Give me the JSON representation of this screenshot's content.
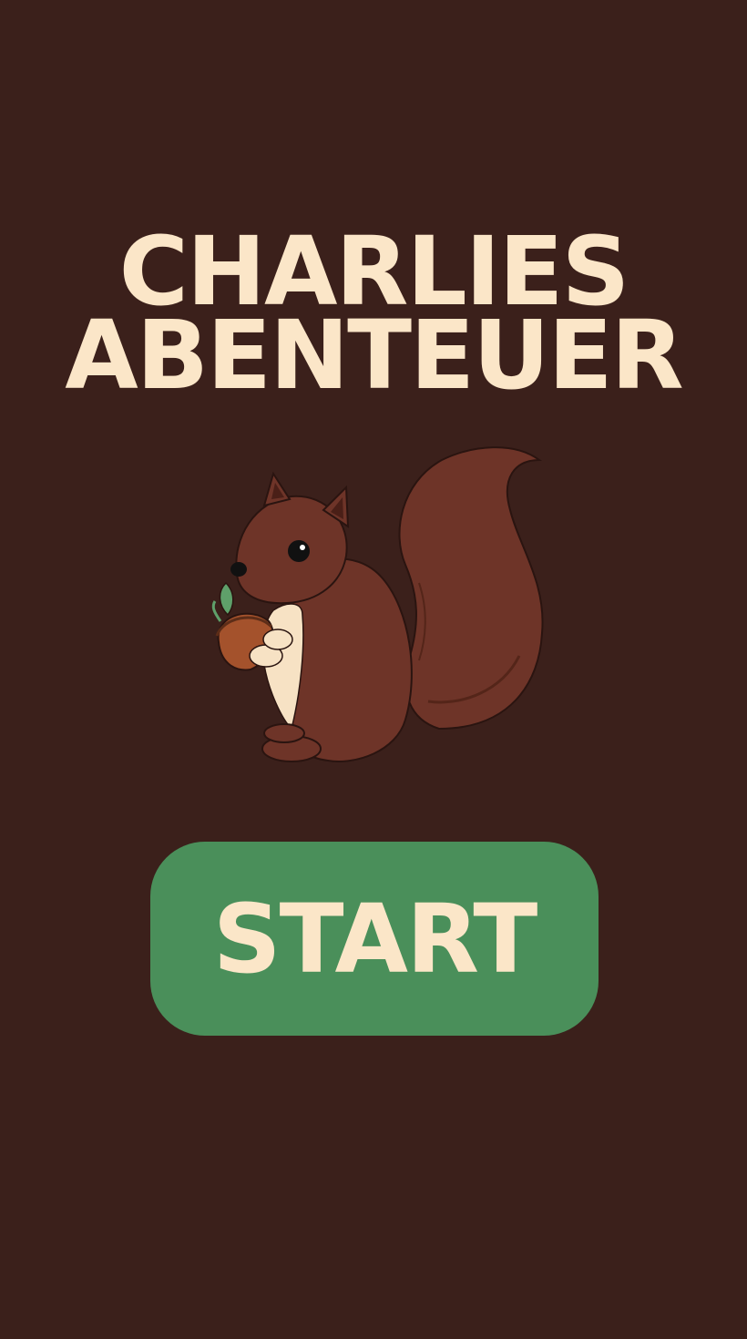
{
  "title": {
    "line1": "CHARLIES",
    "line2": "ABENTEUER"
  },
  "mascot": {
    "icon": "squirrel-holding-acorn-icon"
  },
  "start_button": {
    "label": "START"
  },
  "colors": {
    "background": "#3b201b",
    "title_text": "#fbe6c8",
    "button_bg": "#4a8f5a",
    "button_text": "#fbe6c8",
    "squirrel_fur": "#6e3428",
    "squirrel_belly": "#f7e2c4",
    "acorn": "#a4522c",
    "leaf": "#5fa06a"
  }
}
